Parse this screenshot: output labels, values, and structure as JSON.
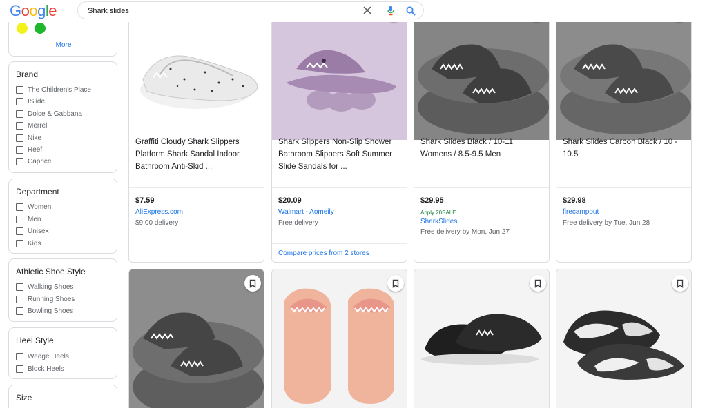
{
  "header": {
    "logo_letters": [
      "G",
      "o",
      "o",
      "g",
      "l",
      "e"
    ],
    "logo_colors": [
      "#4285f4",
      "#ea4335",
      "#fbbc05",
      "#4285f4",
      "#34a853",
      "#ea4335"
    ],
    "search_query": "Shark slides"
  },
  "sidebar": {
    "colors": {
      "swatches": [
        "#f2f21a",
        "#1fb82c"
      ],
      "more_label": "More"
    },
    "brand": {
      "title": "Brand",
      "items": [
        "The Children's Place",
        "ISlide",
        "Dolce & Gabbana",
        "Merrell",
        "Nike",
        "Reef",
        "Caprice"
      ]
    },
    "department": {
      "title": "Department",
      "items": [
        "Women",
        "Men",
        "Unisex",
        "Kids"
      ]
    },
    "athletic_shoe_style": {
      "title": "Athletic Shoe Style",
      "items": [
        "Walking Shoes",
        "Running Shoes",
        "Bowling Shoes"
      ]
    },
    "heel_style": {
      "title": "Heel Style",
      "items": [
        "Wedge Heels",
        "Block Heels"
      ]
    },
    "size": {
      "title": "Size"
    }
  },
  "products": [
    {
      "title": "Graffiti Cloudy Shark Slippers Platform Shark Sandal Indoor Bathroom Anti-Skid ...",
      "price": "$7.59",
      "store": "AliExpress.com",
      "shipping": "$9.00 delivery"
    },
    {
      "title": "Shark Slippers Non-Slip Shower Bathroom Slippers Soft Summer Slide Sandals for ...",
      "price": "$20.09",
      "store": "Walmart - Aomeily",
      "shipping": "Free delivery",
      "compare": "Compare prices from 2 stores"
    },
    {
      "title": "Shark Slides Black / 10-11 Womens / 8.5-9.5 Men",
      "price": "$29.95",
      "promo": "Apply 20SALE",
      "store": "SharkSlides",
      "shipping": "Free delivery by Mon, Jun 27"
    },
    {
      "title": "Shark Slides  Carbon Black / 10 - 10.5",
      "price": "$29.98",
      "store": "firecampout",
      "shipping": "Free delivery by Tue, Jun 28"
    }
  ],
  "colors": {
    "link_blue": "#1a73e8",
    "promo_green": "#188038",
    "border": "#dadce0"
  },
  "icons": [
    "clear-icon",
    "mic-icon",
    "search-icon",
    "bookmark-icon"
  ]
}
